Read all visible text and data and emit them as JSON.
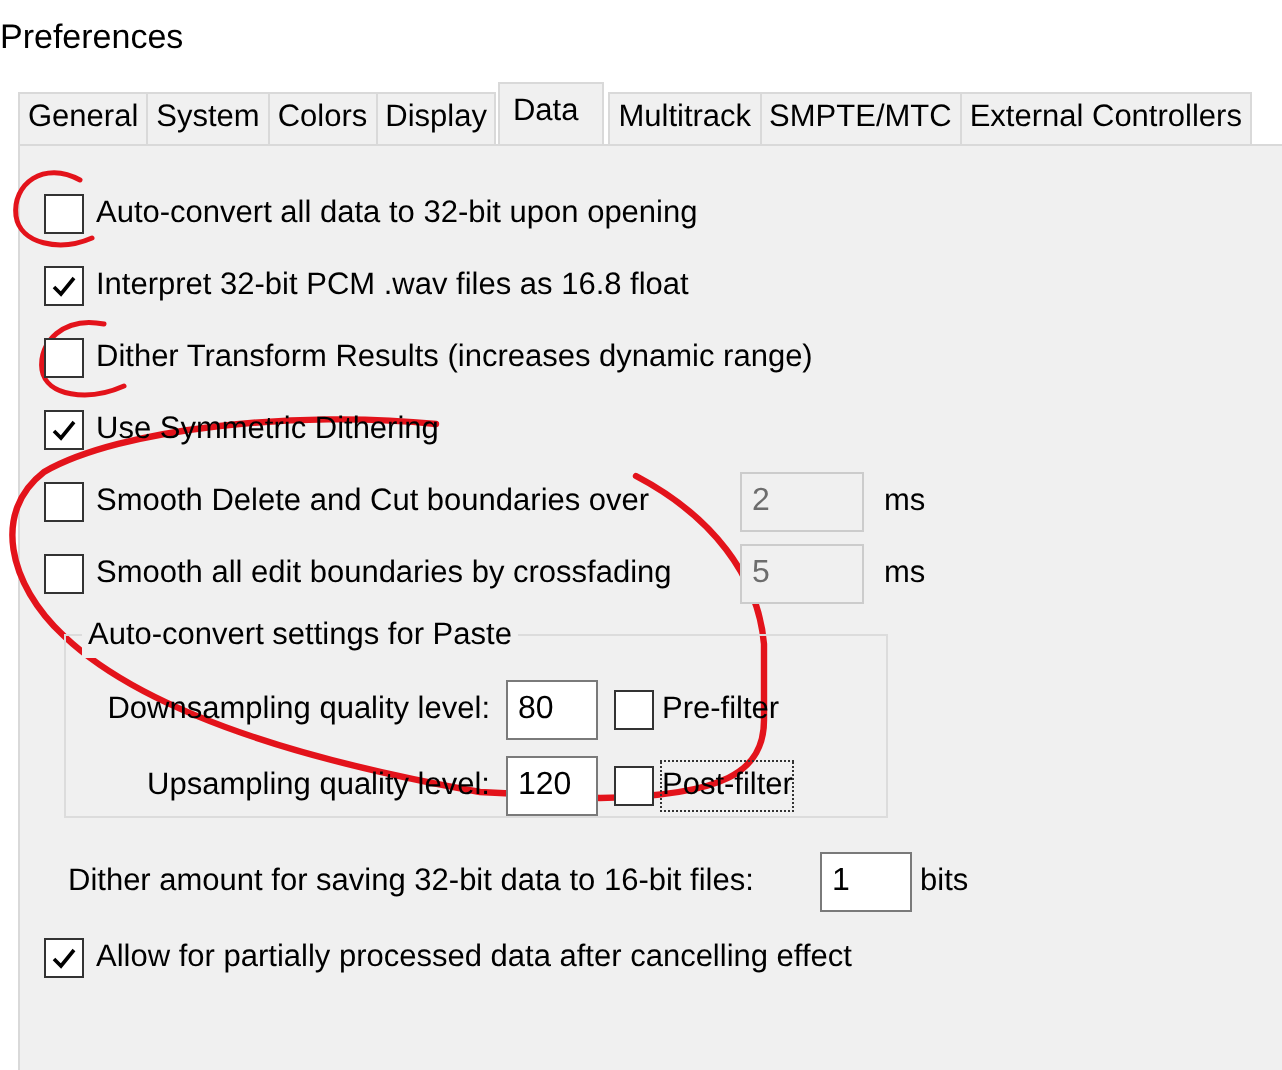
{
  "window": {
    "title": "Preferences"
  },
  "tabs": [
    {
      "label": "General",
      "selected": false
    },
    {
      "label": "System",
      "selected": false
    },
    {
      "label": "Colors",
      "selected": false
    },
    {
      "label": "Display",
      "selected": false
    },
    {
      "label": "Data",
      "selected": true
    },
    {
      "label": "Multitrack",
      "selected": false
    },
    {
      "label": "SMPTE/MTC",
      "selected": false
    },
    {
      "label": "External Controllers",
      "selected": false
    }
  ],
  "options": [
    {
      "kind": "check",
      "label": "Auto-convert all data to 32-bit upon opening",
      "checked": false
    },
    {
      "kind": "check",
      "label": "Interpret 32-bit PCM .wav files as 16.8 float",
      "checked": true
    },
    {
      "kind": "check",
      "label": "Dither Transform Results (increases dynamic range)",
      "checked": false
    },
    {
      "kind": "check",
      "label": "Use Symmetric Dithering",
      "checked": true
    },
    {
      "kind": "check-value",
      "label": "Smooth Delete and Cut boundaries over",
      "checked": false,
      "value": "2",
      "disabled": true,
      "unit": "ms"
    },
    {
      "kind": "check-value",
      "label": "Smooth all edit boundaries by crossfading",
      "checked": false,
      "value": "5",
      "disabled": true,
      "unit": "ms"
    }
  ],
  "paste_group": {
    "title": "Auto-convert settings for Paste",
    "rows": [
      {
        "label": "Downsampling quality level:",
        "value": "80",
        "filter": "Pre-filter",
        "checked": false,
        "focused": false
      },
      {
        "label": "Upsampling quality level:",
        "value": "120",
        "filter": "Post-filter",
        "checked": false,
        "focused": true
      }
    ]
  },
  "dither_amount": {
    "label": "Dither amount for saving 32-bit data to 16-bit files:",
    "value": "1",
    "unit": "bits"
  },
  "final_option": {
    "label": "Allow for partially processed data after cancelling effect",
    "checked": true
  },
  "annotations": [
    {
      "kind": "circle"
    },
    {
      "kind": "circle"
    },
    {
      "kind": "loop"
    }
  ]
}
